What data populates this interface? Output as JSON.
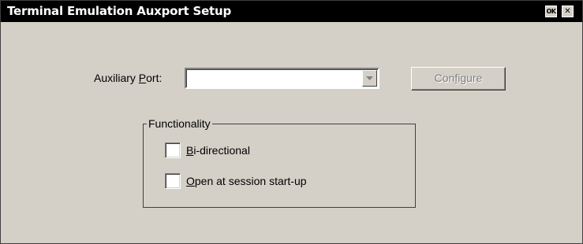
{
  "window": {
    "title": "Terminal Emulation Auxport Setup",
    "ok_button_label": "OK",
    "close_button_glyph": "✕"
  },
  "auxiliary_port": {
    "label_pre": "Auxiliary ",
    "label_mnemonic": "P",
    "label_post": "ort:",
    "value": "",
    "dropdown_icon": "chevron-down-icon"
  },
  "configure_button": {
    "label_pre": "Con",
    "label_mnemonic": "f",
    "label_post": "igure",
    "enabled": false
  },
  "functionality": {
    "legend": "Functionality",
    "bidirectional": {
      "label_mnemonic": "B",
      "label_post": "i-directional",
      "checked": false
    },
    "open_at_startup": {
      "label_mnemonic": "O",
      "label_post": "pen at session start-up",
      "checked": false
    }
  },
  "colors": {
    "title_bar": "#000000",
    "dialog_face": "#d4d0c8",
    "disabled_text": "#808080"
  }
}
